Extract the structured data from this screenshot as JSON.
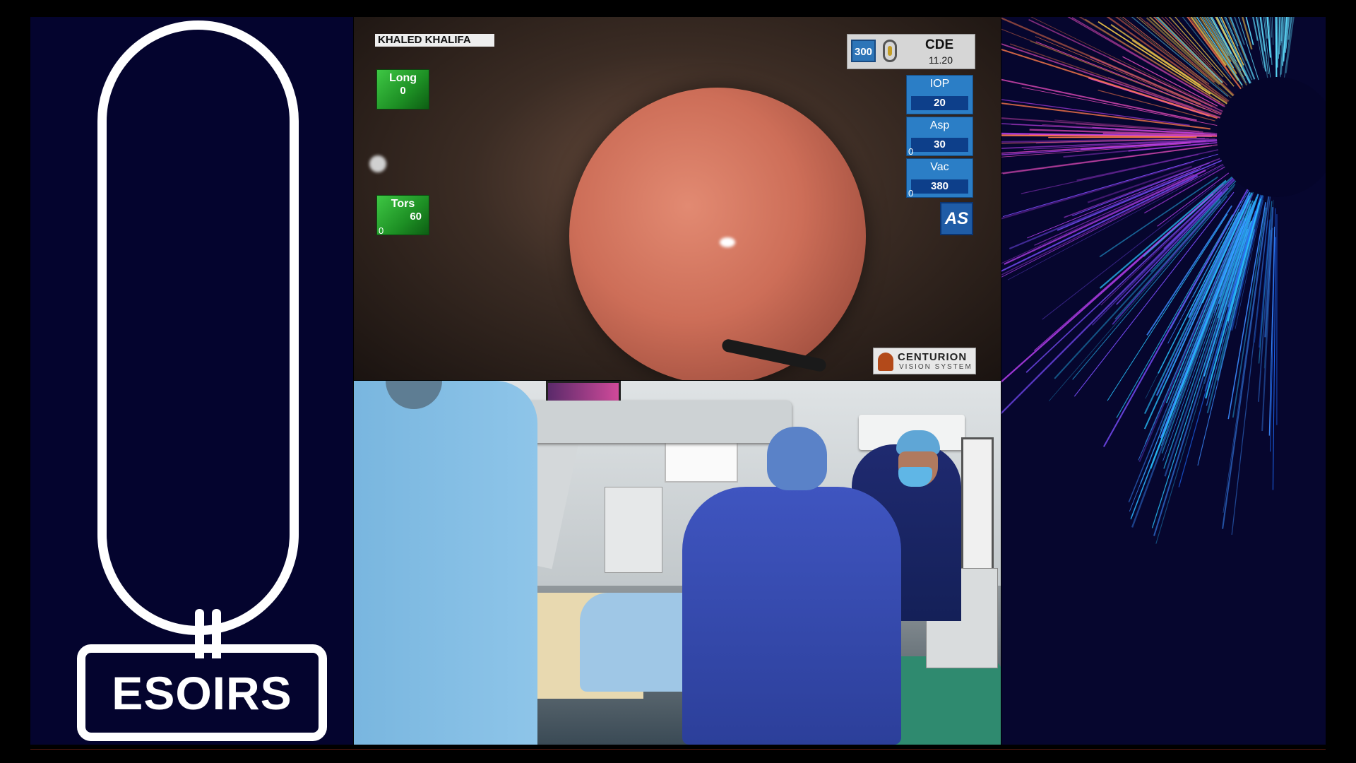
{
  "logo": {
    "text": "ESOIRS"
  },
  "surgery_overlay": {
    "patient_name": "KHALED KHALIFA",
    "long": {
      "label": "Long",
      "value": "0"
    },
    "tors": {
      "label": "Tors",
      "value": "60",
      "min": "0"
    },
    "cde": {
      "power": "300",
      "label": "CDE",
      "value": "11.20"
    },
    "iop": {
      "label": "IOP",
      "value": "20"
    },
    "asp": {
      "label": "Asp",
      "value": "30",
      "min": "0"
    },
    "vac": {
      "label": "Vac",
      "value": "380",
      "min": "0"
    },
    "as_label": "AS",
    "brand": {
      "name": "CENTURION",
      "sub": "VISION SYSTEM"
    }
  },
  "colors": {
    "background": "#04042e",
    "green_indicator": "#2fae36",
    "blue_indicator": "#2b7ec6"
  }
}
